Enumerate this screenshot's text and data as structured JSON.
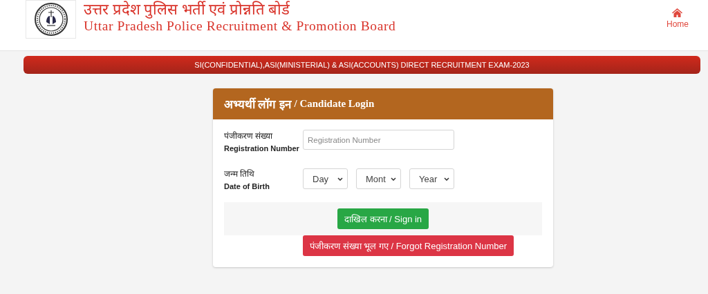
{
  "header": {
    "title_hindi": "उत्तर प्रदेश पुलिस भर्ती एवं प्रोन्नति बोर्ड",
    "title_english": "Uttar Pradesh Police Recruitment & Promotion Board",
    "nav": [
      {
        "label": "Home",
        "kind": "home"
      }
    ]
  },
  "banner": "SI(CONFIDENTIAL),ASI(MINISTERIAL) & ASI(ACCOUNTS) DIRECT RECRUITMENT EXAM-2023",
  "login": {
    "title_hindi": "अभ्यर्थी लॉग इन",
    "title_english": "/ Candidate Login",
    "fields": [
      {
        "kind": "text",
        "label_hindi": "पंजीकरण संख्या",
        "label_english": "Registration Number",
        "placeholder": "Registration Number"
      },
      {
        "kind": "date",
        "label_hindi": "जन्म तिथि",
        "label_english": "Date of Birth",
        "selects": [
          "Day",
          "Mont",
          "Year"
        ]
      }
    ],
    "sign_in": "दाखिल करना / Sign in",
    "forgot": "पंजीकरण संख्या भूल गए / Forgot Registration Number"
  }
}
